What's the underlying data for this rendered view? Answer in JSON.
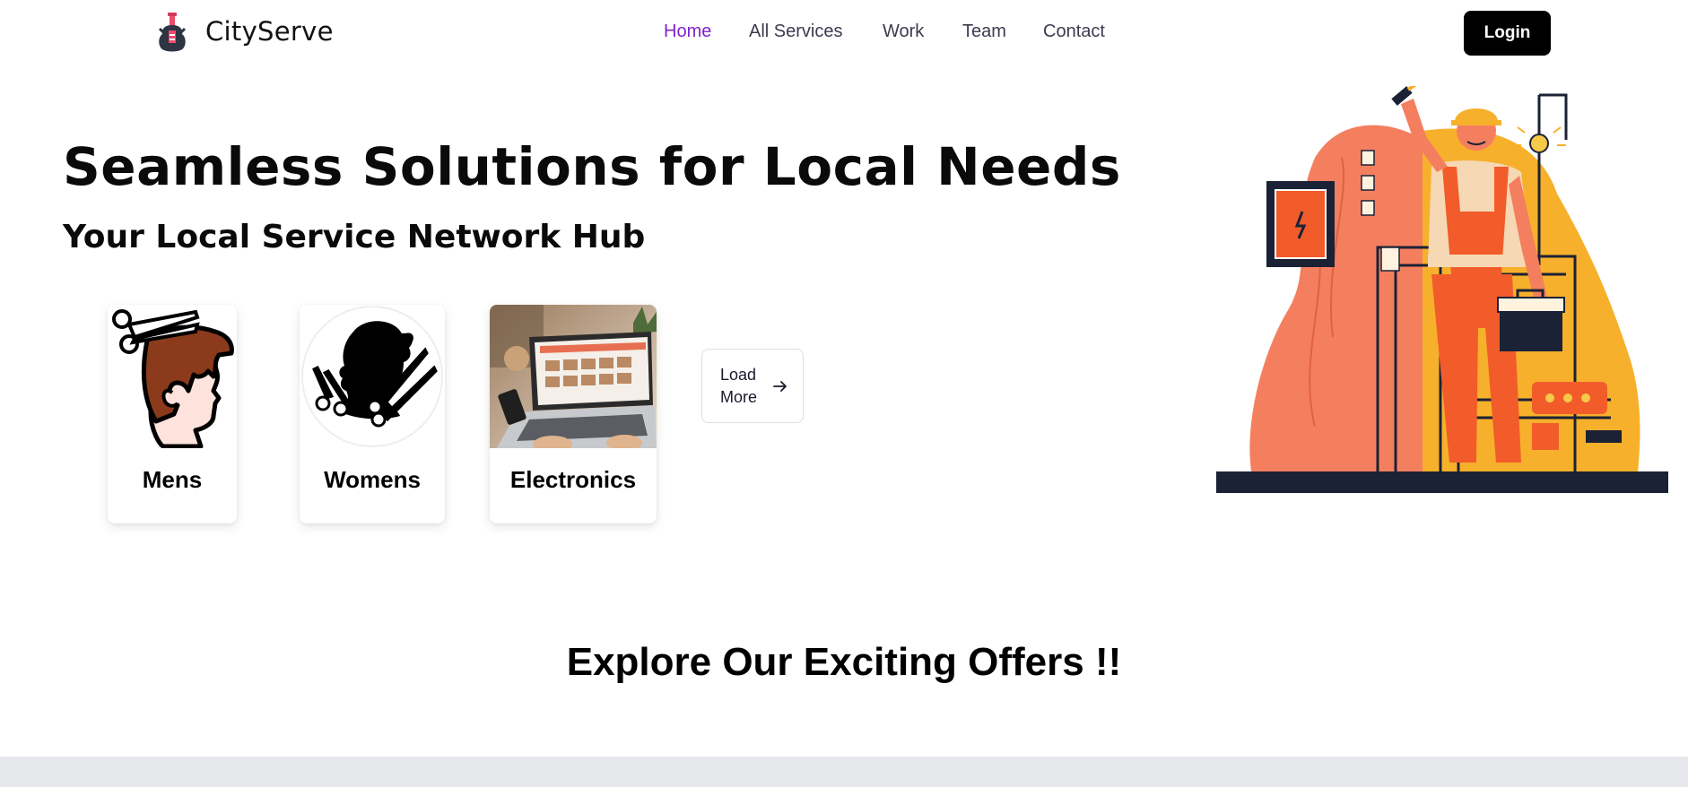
{
  "brand": {
    "name": "CityServe",
    "logo_icon": "guitar-icon"
  },
  "nav": {
    "items": [
      {
        "label": "Home",
        "active": true
      },
      {
        "label": "All Services",
        "active": false
      },
      {
        "label": "Work",
        "active": false
      },
      {
        "label": "Team",
        "active": false
      },
      {
        "label": "Contact",
        "active": false
      }
    ],
    "login_label": "Login"
  },
  "hero": {
    "title": "Seamless Solutions for Local Needs",
    "subtitle": "Your Local Service Network Hub",
    "categories": [
      {
        "label": "Mens",
        "icon": "mens-haircut-icon"
      },
      {
        "label": "Womens",
        "icon": "womens-haircut-icon"
      },
      {
        "label": "Electronics",
        "icon": "laptop-photo"
      }
    ],
    "load_more_label": "Load More",
    "illustration": "electrician-illustration"
  },
  "offers": {
    "title": "Explore Our Exciting Offers !!"
  },
  "colors": {
    "accent": "#7e22ce",
    "nav_text": "#3b3b4f",
    "button_bg": "#000000",
    "illus_orange": "#f25c2a",
    "illus_yellow": "#f7b02b",
    "illus_navy": "#1b2236"
  }
}
